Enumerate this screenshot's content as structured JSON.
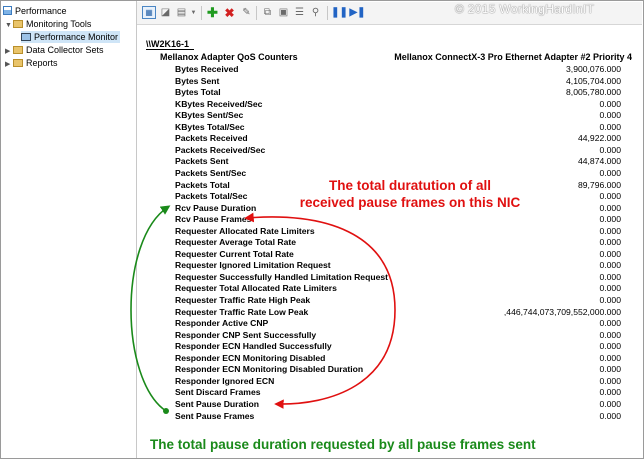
{
  "tree": {
    "items": [
      {
        "label": "Performance",
        "level": 0,
        "icon": "performance-icon",
        "expanded": true,
        "selected": false
      },
      {
        "label": "Monitoring Tools",
        "level": 1,
        "icon": "folder-icon",
        "expanded": true,
        "selected": false
      },
      {
        "label": "Performance Monitor",
        "level": 2,
        "icon": "monitor-icon",
        "expanded": false,
        "selected": true
      },
      {
        "label": "Data Collector Sets",
        "level": 1,
        "icon": "folder-icon",
        "expanded": false,
        "selected": false
      },
      {
        "label": "Reports",
        "level": 1,
        "icon": "folder-icon",
        "expanded": false,
        "selected": false
      }
    ]
  },
  "toolbar": {
    "buttons": [
      "view-current-activity",
      "change-graph-type",
      "view-dropdown",
      "add-counter",
      "delete-counter",
      "highlight",
      "copy-properties",
      "paste-counter-list",
      "properties",
      "zoom",
      "freeze-display",
      "update-data"
    ]
  },
  "watermark": "© 2015 WorkingHardInIT",
  "report": {
    "server": "\\\\W2K16-1",
    "object": "Mellanox Adapter QoS Counters",
    "instance": "Mellanox ConnectX-3 Pro Ethernet Adapter #2 Priority 4",
    "counters": [
      {
        "name": "Bytes Received",
        "value": "3,900,076.000"
      },
      {
        "name": "Bytes Sent",
        "value": "4,105,704.000"
      },
      {
        "name": "Bytes Total",
        "value": "8,005,780.000"
      },
      {
        "name": "KBytes Received/Sec",
        "value": "0.000"
      },
      {
        "name": "KBytes Sent/Sec",
        "value": "0.000"
      },
      {
        "name": "KBytes Total/Sec",
        "value": "0.000"
      },
      {
        "name": "Packets Received",
        "value": "44,922.000"
      },
      {
        "name": "Packets Received/Sec",
        "value": "0.000"
      },
      {
        "name": "Packets Sent",
        "value": "44,874.000"
      },
      {
        "name": "Packets Sent/Sec",
        "value": "0.000"
      },
      {
        "name": "Packets Total",
        "value": "89,796.000"
      },
      {
        "name": "Packets Total/Sec",
        "value": "0.000"
      },
      {
        "name": "Rcv Pause Duration",
        "value": "0.000"
      },
      {
        "name": "Rcv Pause Frames",
        "value": "0.000"
      },
      {
        "name": "Requester Allocated Rate Limiters",
        "value": "0.000"
      },
      {
        "name": "Requester Average Total Rate",
        "value": "0.000"
      },
      {
        "name": "Requester Current Total Rate",
        "value": "0.000"
      },
      {
        "name": "Requester Ignored Limitation Request",
        "value": "0.000"
      },
      {
        "name": "Requester Successfully Handled Limitation Request",
        "value": "0.000"
      },
      {
        "name": "Requester Total Allocated Rate Limiters",
        "value": "0.000"
      },
      {
        "name": "Requester Traffic Rate High Peak",
        "value": "0.000"
      },
      {
        "name": "Requester Traffic Rate Low Peak",
        "value": ",446,744,073,709,552,000.000"
      },
      {
        "name": "Responder Active CNP",
        "value": "0.000"
      },
      {
        "name": "Responder CNP Sent Successfully",
        "value": "0.000"
      },
      {
        "name": "Responder ECN Handled Successfully",
        "value": "0.000"
      },
      {
        "name": "Responder ECN Monitoring Disabled",
        "value": "0.000"
      },
      {
        "name": "Responder ECN Monitoring Disabled Duration",
        "value": "0.000"
      },
      {
        "name": "Responder Ignored ECN",
        "value": "0.000"
      },
      {
        "name": "Sent Discard Frames",
        "value": "0.000"
      },
      {
        "name": "Sent Pause Duration",
        "value": "0.000"
      },
      {
        "name": "Sent Pause Frames",
        "value": "0.000"
      }
    ]
  },
  "annotations": {
    "red_line1": "The total duratution of all",
    "red_line2": "received pause frames on this NIC",
    "green": "The total pause duration requested by all pause frames sent",
    "red_color": "#e01010",
    "green_color": "#1a8a1a"
  }
}
